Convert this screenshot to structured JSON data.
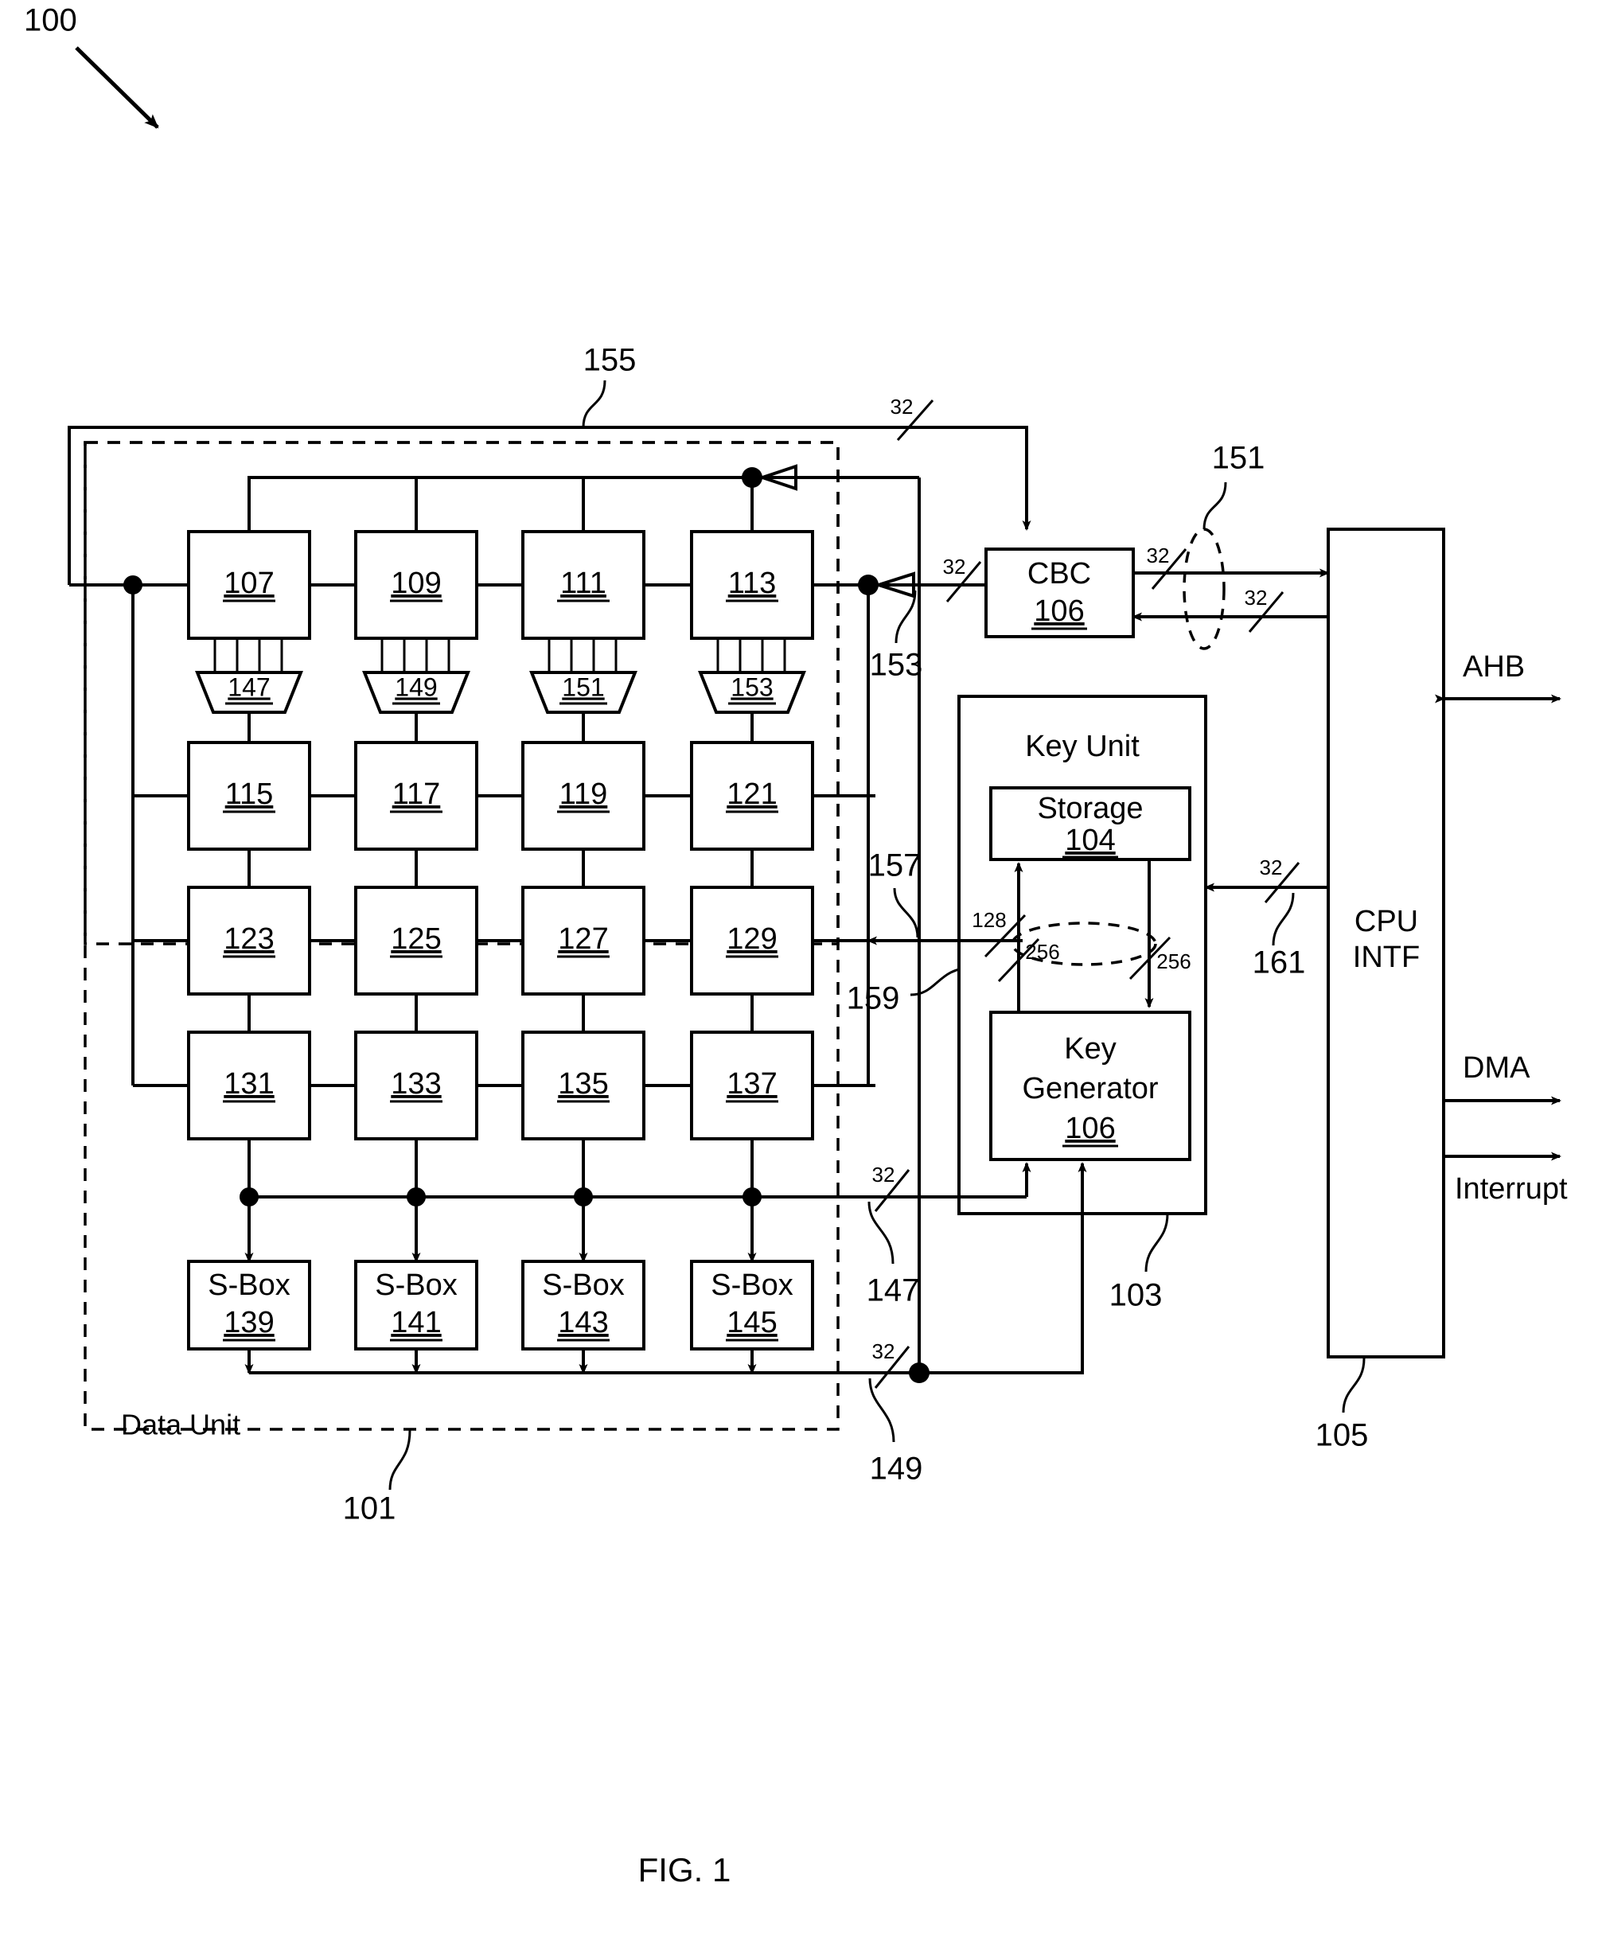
{
  "figure": {
    "caption": "FIG. 1",
    "system_ref": "100"
  },
  "units": {
    "data_unit": {
      "label": "Data Unit",
      "ref": "101"
    },
    "key_unit": {
      "label": "Key Unit",
      "ref": "103"
    },
    "cpu_interface": {
      "label_line1": "CPU",
      "label_line2": "INTF",
      "ref": "105"
    }
  },
  "blocks": {
    "cbc": {
      "label": "CBC",
      "num": "106"
    },
    "storage": {
      "label": "Storage",
      "num": "104"
    },
    "key_generator": {
      "label_line1": "Key",
      "label_line2": "Generator",
      "num": "106"
    }
  },
  "register_grid": {
    "row1": [
      "107",
      "109",
      "111",
      "113"
    ],
    "row2": [
      "115",
      "117",
      "119",
      "121"
    ],
    "row3": [
      "123",
      "125",
      "127",
      "129"
    ],
    "row4": [
      "131",
      "133",
      "135",
      "137"
    ]
  },
  "mux_row": [
    "147",
    "149",
    "151",
    "153"
  ],
  "sbox_row": {
    "label": "S-Box",
    "nums": [
      "139",
      "141",
      "143",
      "145"
    ]
  },
  "signal_refs": {
    "loopback_top": "155",
    "cbc_to_row1": "153",
    "row3_feedback": "157",
    "key_bus": "159",
    "sbox_input_bus": "147",
    "sbox_output_bus": "149",
    "ahb_bundle": "151",
    "cpu_key_bus": "161"
  },
  "bus_widths": {
    "loopback_32": "32",
    "cbc_in_32": "32",
    "cbc_out_32": "32",
    "cbc_back_32": "32",
    "ahb_out_32": "32",
    "ahb_in_32": "32",
    "cpu_key_32": "32",
    "sbox_in_32": "32",
    "sbox_out_32": "32",
    "keygen_in_32": "32",
    "key_128": "128",
    "key_256_a": "256",
    "key_256_b": "256"
  },
  "external_ports": {
    "ahb": "AHB",
    "dma": "DMA",
    "interrupt": "Interrupt"
  }
}
